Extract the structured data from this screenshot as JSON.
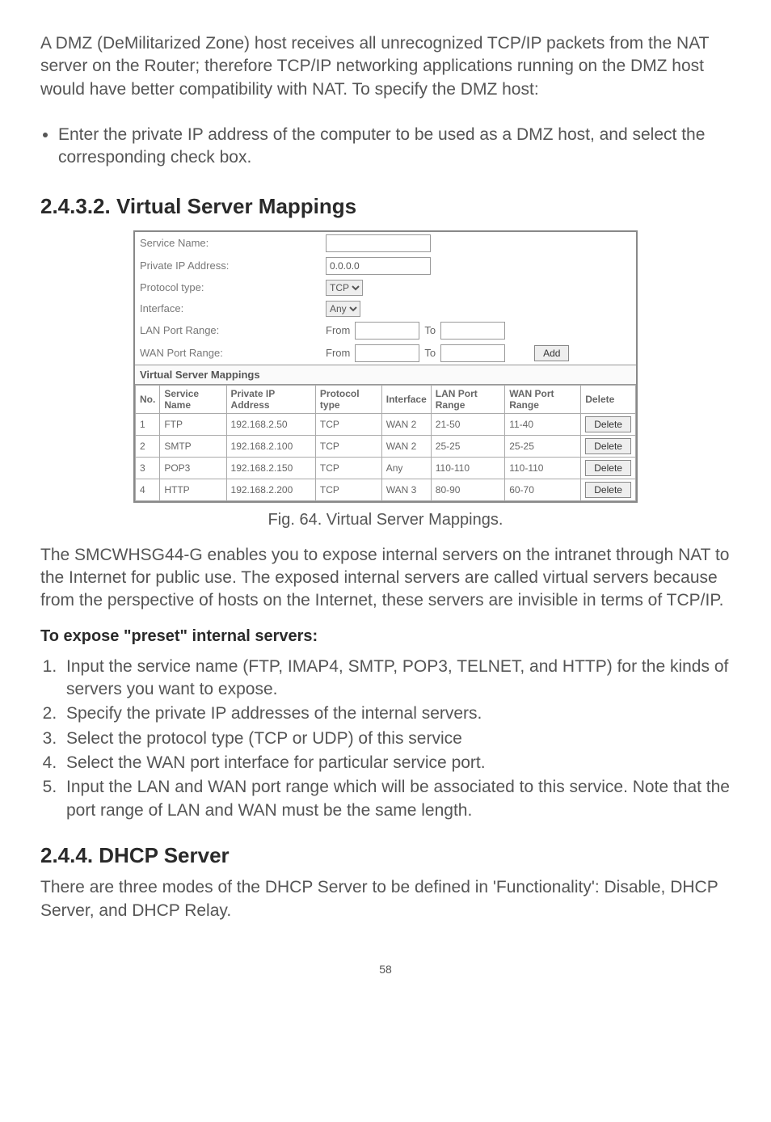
{
  "intro": {
    "p1": "A DMZ (DeMilitarized Zone) host receives all unrecognized TCP/IP packets from the NAT server on the Router; therefore TCP/IP networking applications running on the DMZ host would have better compatibility with NAT. To specify the DMZ host:",
    "bullet": "Enter the private IP address of the computer to be used as a DMZ host, and select the corresponding check box."
  },
  "heading1": "2.4.3.2. Virtual Server Mappings",
  "form": {
    "service_name_label": "Service Name:",
    "service_name_value": "",
    "private_ip_label": "Private IP Address:",
    "private_ip_value": "0.0.0.0",
    "protocol_label": "Protocol type:",
    "protocol_value": "TCP",
    "interface_label": "Interface:",
    "interface_value": "Any",
    "lan_range_label": "LAN Port Range:",
    "wan_range_label": "WAN Port Range:",
    "from_label": "From",
    "to_label": "To",
    "add_button": "Add",
    "sub_header": "Virtual Server Mappings"
  },
  "table": {
    "headers": {
      "no": "No.",
      "service": "Service Name",
      "ip": "Private IP Address",
      "proto": "Protocol type",
      "iface": "Interface",
      "lan": "LAN Port Range",
      "wan": "WAN Port Range",
      "del": "Delete"
    },
    "rows": [
      {
        "no": "1",
        "service": "FTP",
        "ip": "192.168.2.50",
        "proto": "TCP",
        "iface": "WAN 2",
        "lan": "21-50",
        "wan": "11-40"
      },
      {
        "no": "2",
        "service": "SMTP",
        "ip": "192.168.2.100",
        "proto": "TCP",
        "iface": "WAN 2",
        "lan": "25-25",
        "wan": "25-25"
      },
      {
        "no": "3",
        "service": "POP3",
        "ip": "192.168.2.150",
        "proto": "TCP",
        "iface": "Any",
        "lan": "110-110",
        "wan": "110-110"
      },
      {
        "no": "4",
        "service": "HTTP",
        "ip": "192.168.2.200",
        "proto": "TCP",
        "iface": "WAN 3",
        "lan": "80-90",
        "wan": "60-70"
      }
    ],
    "delete_label": "Delete"
  },
  "caption": "Fig. 64. Virtual Server Mappings.",
  "body2": "The SMCWHSG44-G enables you to expose internal servers on the intranet through NAT to the Internet for public use. The exposed internal servers are called virtual servers because from the perspective of hosts on the Internet, these servers are invisible in terms of TCP/IP.",
  "sub_bold": "To expose \"preset\" internal servers:",
  "steps": [
    "Input the service name (FTP, IMAP4, SMTP, POP3, TELNET, and HTTP) for the kinds of servers you want to expose.",
    "Specify the private IP addresses of the internal servers.",
    "Select the protocol type (TCP or UDP) of this service",
    "Select the WAN port interface for particular service port.",
    "Input the LAN and WAN port range which will be associated to this service. Note that the port range of LAN and WAN must be the same length."
  ],
  "heading2": "2.4.4. DHCP Server",
  "body3": "There are three modes of the DHCP Server to be defined in 'Functionality': Disable, DHCP Server, and DHCP Relay.",
  "page_number": "58"
}
